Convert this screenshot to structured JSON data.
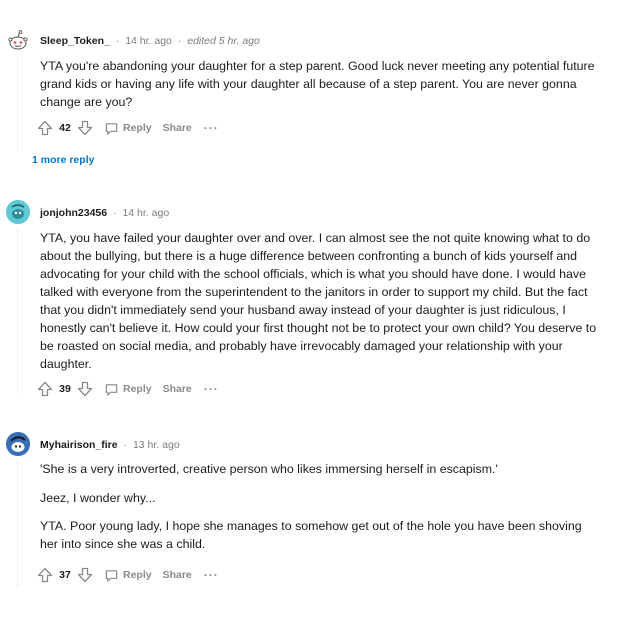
{
  "comments": [
    {
      "username": "Sleep_Token_",
      "time": "14 hr. ago",
      "edited": "edited 5 hr. ago",
      "paragraphs": [
        "YTA you're abandoning your daughter for a step parent. Good luck never meeting any potential future grand kids or having any life with your daughter all because of a step parent. You are never gonna change are you?"
      ],
      "votes": "42",
      "reply_label": "Reply",
      "share_label": "Share",
      "more_label": "···",
      "more_replies": "1 more reply"
    },
    {
      "username": "jonjohn23456",
      "time": "14 hr. ago",
      "paragraphs": [
        "YTA, you have failed your daughter over and over. I can almost see the not quite knowing what to do about the bullying, but there is a huge difference between confronting a bunch of kids yourself and advocating for your child with the school officials, which is what you should have done. I would have talked with everyone from the superintendent to the janitors in order to support my child. But the fact that you didn't immediately send your husband away instead of your daughter is just ridiculous, I honestly can't believe it. How could your first thought not be to protect your own child? You deserve to be roasted on social media, and probably have irrevocably damaged your relationship with your daughter."
      ],
      "votes": "39",
      "reply_label": "Reply",
      "share_label": "Share",
      "more_label": "···"
    },
    {
      "username": "Myhairison_fire",
      "time": "13 hr. ago",
      "paragraphs": [
        "'She is a very introverted, creative person who likes immersing herself in escapism.'",
        "Jeez, I wonder why...",
        "YTA. Poor young lady, I hope she manages to somehow get out of the hole you have been shoving her into since she was a child."
      ],
      "votes": "37",
      "reply_label": "Reply",
      "share_label": "Share",
      "more_label": "···"
    }
  ],
  "colors": {
    "username": "#1c1c1c",
    "meta": "#787c7e",
    "action": "#878a8c",
    "link": "#0079d3"
  },
  "icons": [
    "snoo-avatar",
    "user-avatar",
    "upvote-icon",
    "downvote-icon",
    "reply-icon",
    "more-options-icon"
  ]
}
